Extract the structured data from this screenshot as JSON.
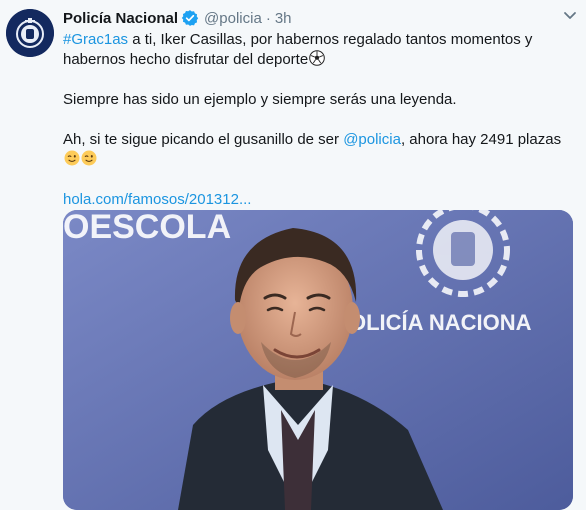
{
  "tweet": {
    "author_name": "Policía Nacional",
    "handle": "@policia",
    "separator": "·",
    "time": "3h",
    "line1_hashtag": "#Grac1as",
    "line1_rest": " a ti, Iker Casillas, por habernos regalado tantos momentos y",
    "line2": "habernos hecho disfrutar del deporte",
    "line3": "Siempre has sido un ejemplo y siempre serás una leyenda.",
    "line4_start": "Ah, si te sigue picando el gusanillo de ser ",
    "line4_mention": "@policia",
    "line4_end": ", ahora hay 2491 plazas",
    "link_text": "hola.com/famosos/201312...",
    "image_banner_left": "OESCOLA",
    "image_banner_right": "OLICÍA NACIONA"
  },
  "icons": {
    "verified": "verified-badge-icon",
    "caret": "chevron-down-icon",
    "soccer": "soccer-ball-emoji",
    "wink": "winking-face-emoji"
  },
  "colors": {
    "link": "#1b95e0",
    "verified": "#1da1f2",
    "text": "#14171a",
    "muted": "#657786",
    "background": "#f5f8fa"
  }
}
